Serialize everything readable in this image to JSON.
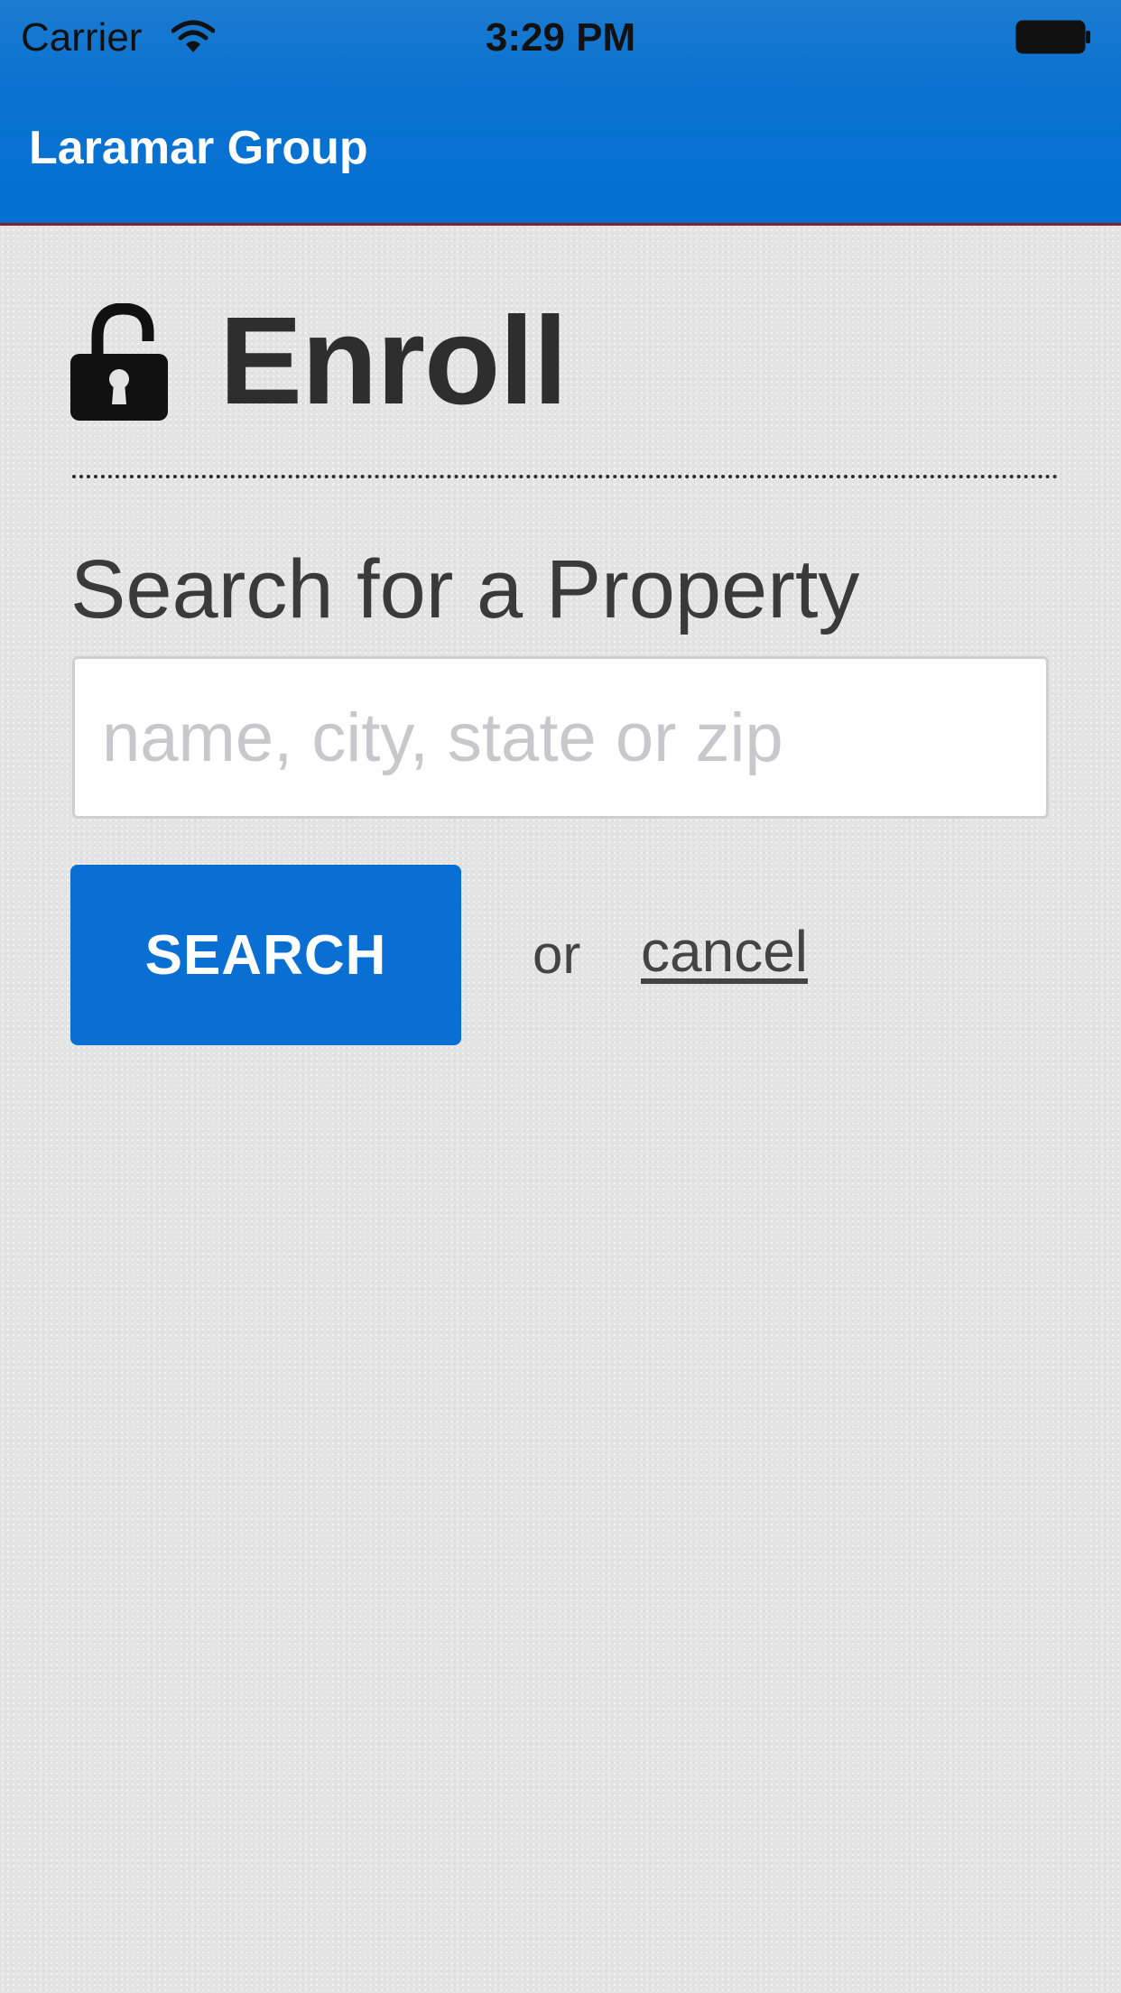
{
  "status_bar": {
    "carrier": "Carrier",
    "time": "3:29 PM"
  },
  "header": {
    "title": "Laramar Group"
  },
  "enroll": {
    "title": "Enroll",
    "icon": "lock-open-icon"
  },
  "search": {
    "label": "Search for a Property",
    "placeholder": "name, city, state or zip",
    "value": "",
    "button_label": "SEARCH",
    "or_text": "or",
    "cancel_label": "cancel"
  },
  "colors": {
    "accent": "#0a6fd2",
    "header_border": "#7a2230",
    "text": "#2e2e2e"
  }
}
